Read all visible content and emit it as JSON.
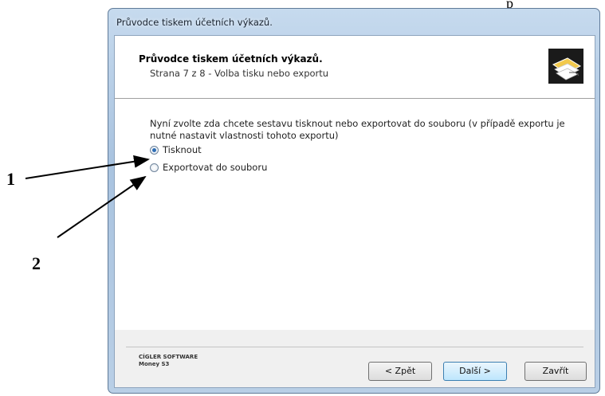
{
  "corner_text": "p",
  "window": {
    "title": "Průvodce tiskem účetních výkazů."
  },
  "header": {
    "title": "Průvodce tiskem účetních výkazů.",
    "subtitle": "Strana 7 z 8 - Volba tisku nebo exportu",
    "icon": "printer-document-icon"
  },
  "body": {
    "instruction": "Nyní zvolte zda chcete sestavu tisknout nebo exportovat do souboru (v případě exportu je nutné nastavit vlastnosti tohoto exportu)",
    "options": [
      {
        "label": "Tisknout",
        "checked": true
      },
      {
        "label": "Exportovat do souboru",
        "checked": false
      }
    ]
  },
  "footer": {
    "vendor": "CÍGLER SOFTWARE",
    "product": "Money S3",
    "back_label": "< Zpět",
    "next_label": "Další >",
    "close_label": "Zavřít"
  },
  "annotations": {
    "label_1": "1",
    "label_2": "2"
  }
}
